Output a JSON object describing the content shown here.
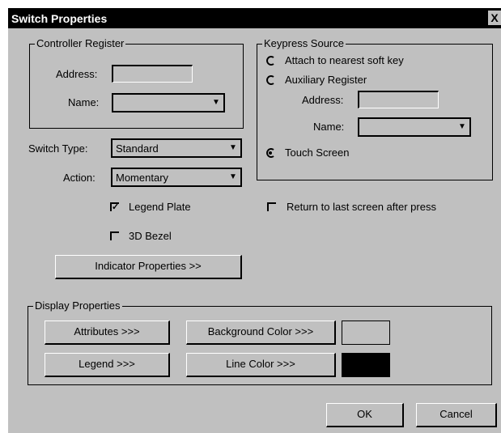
{
  "window": {
    "title": "Switch Properties",
    "close_glyph": "X"
  },
  "controller_register": {
    "legend": "Controller Register",
    "address_label": "Address:",
    "address_value": "",
    "name_label": "Name:",
    "name_value": ""
  },
  "keypress_source": {
    "legend": "Keypress Source",
    "options": [
      {
        "label": "Attach to nearest soft key",
        "selected": false
      },
      {
        "label": "Auxiliary Register",
        "selected": false
      },
      {
        "label": "Touch Screen",
        "selected": true
      }
    ],
    "aux_address_label": "Address:",
    "aux_address_value": "",
    "aux_name_label": "Name:",
    "aux_name_value": ""
  },
  "switch_type": {
    "label": "Switch Type:",
    "value": "Standard"
  },
  "action": {
    "label": "Action:",
    "value": "Momentary"
  },
  "checkboxes": {
    "legend_plate": {
      "label": "Legend Plate",
      "checked": true
    },
    "bezel_3d": {
      "label": "3D Bezel",
      "checked": false
    },
    "return_last": {
      "label": "Return to last screen after press",
      "checked": false
    }
  },
  "indicator_button": "Indicator Properties >>",
  "display_properties": {
    "legend": "Display Properties",
    "attributes_button": "Attributes >>>",
    "legend_button": "Legend >>>",
    "background_color_button": "Background Color >>>",
    "line_color_button": "Line Color >>>",
    "background_color": "#c0c0c0",
    "line_color": "#000000"
  },
  "ok_button": "OK",
  "cancel_button": "Cancel",
  "icons": {
    "combo_arrow": "chevron-down-icon",
    "check": "checkmark-icon"
  }
}
